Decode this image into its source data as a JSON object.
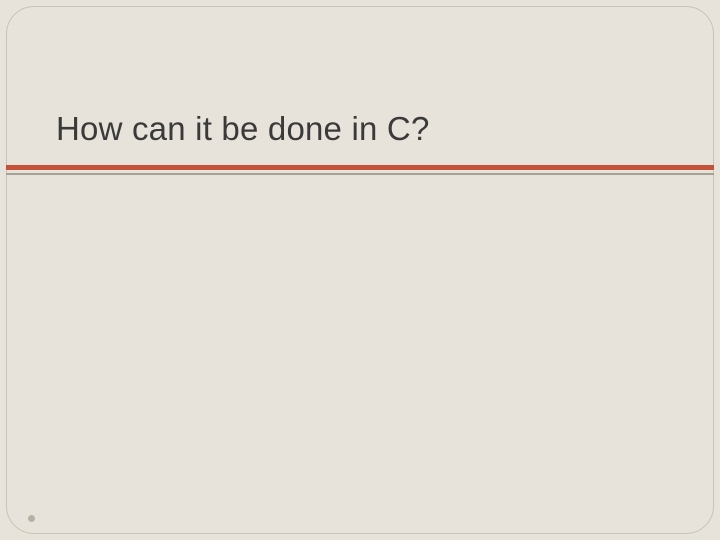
{
  "slide": {
    "title": "How can it be done in C?"
  },
  "colors": {
    "background": "#e8e3da",
    "accent": "#c45238",
    "border": "#c9c2b5"
  }
}
